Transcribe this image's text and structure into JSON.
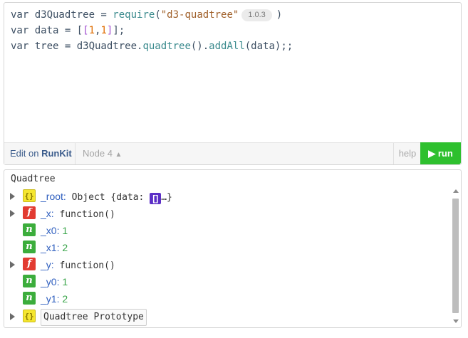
{
  "editor": {
    "line1": {
      "prefix": "var d3Quadtree = ",
      "fn": "require",
      "open": "(",
      "str": "\"d3-quadtree\"",
      "version": "1.0.3",
      "close": ")"
    },
    "line2": {
      "prefix": "var data = [",
      "inner_open": "[",
      "n1": "1",
      "comma": ",",
      "n2": "1",
      "inner_close": "]",
      "suffix": "];"
    },
    "line3": {
      "prefix": "var tree = d3Quadtree.",
      "fn1": "quadtree",
      "mid": "().",
      "fn2": "addAll",
      "suffix": "(data);;"
    }
  },
  "toolbar": {
    "edit_prefix": "Edit on ",
    "edit_brand": "RunKit",
    "node_version": "Node 4",
    "help_label": "help",
    "run_label": "run"
  },
  "output": {
    "title": "Quadtree",
    "rows": [
      {
        "key": "_root",
        "sep": ":",
        "value": " Object {data: ",
        "value_end": "…}",
        "badge": "{}"
      },
      {
        "key": "_x",
        "sep": ":",
        "value": " function()",
        "badge": "f"
      },
      {
        "key": "_x0",
        "sep": ":",
        "value": " 1",
        "badge": "n"
      },
      {
        "key": "_x1",
        "sep": ":",
        "value": " 2",
        "badge": "n"
      },
      {
        "key": "_y",
        "sep": ":",
        "value": " function()",
        "badge": "f"
      },
      {
        "key": "_y0",
        "sep": ":",
        "value": " 1",
        "badge": "n"
      },
      {
        "key": "_y1",
        "sep": ":",
        "value": " 2",
        "badge": "n"
      },
      {
        "key": "",
        "sep": "",
        "value": "Quadtree Prototype",
        "badge": "{}"
      }
    ],
    "array_badge": "[]"
  },
  "colors": {
    "run_green": "#2ec02e",
    "fn_red": "#e23b31",
    "num_green": "#3cad3c",
    "obj_yellow": "#f5e62f",
    "arr_purple": "#5c2fc6"
  }
}
